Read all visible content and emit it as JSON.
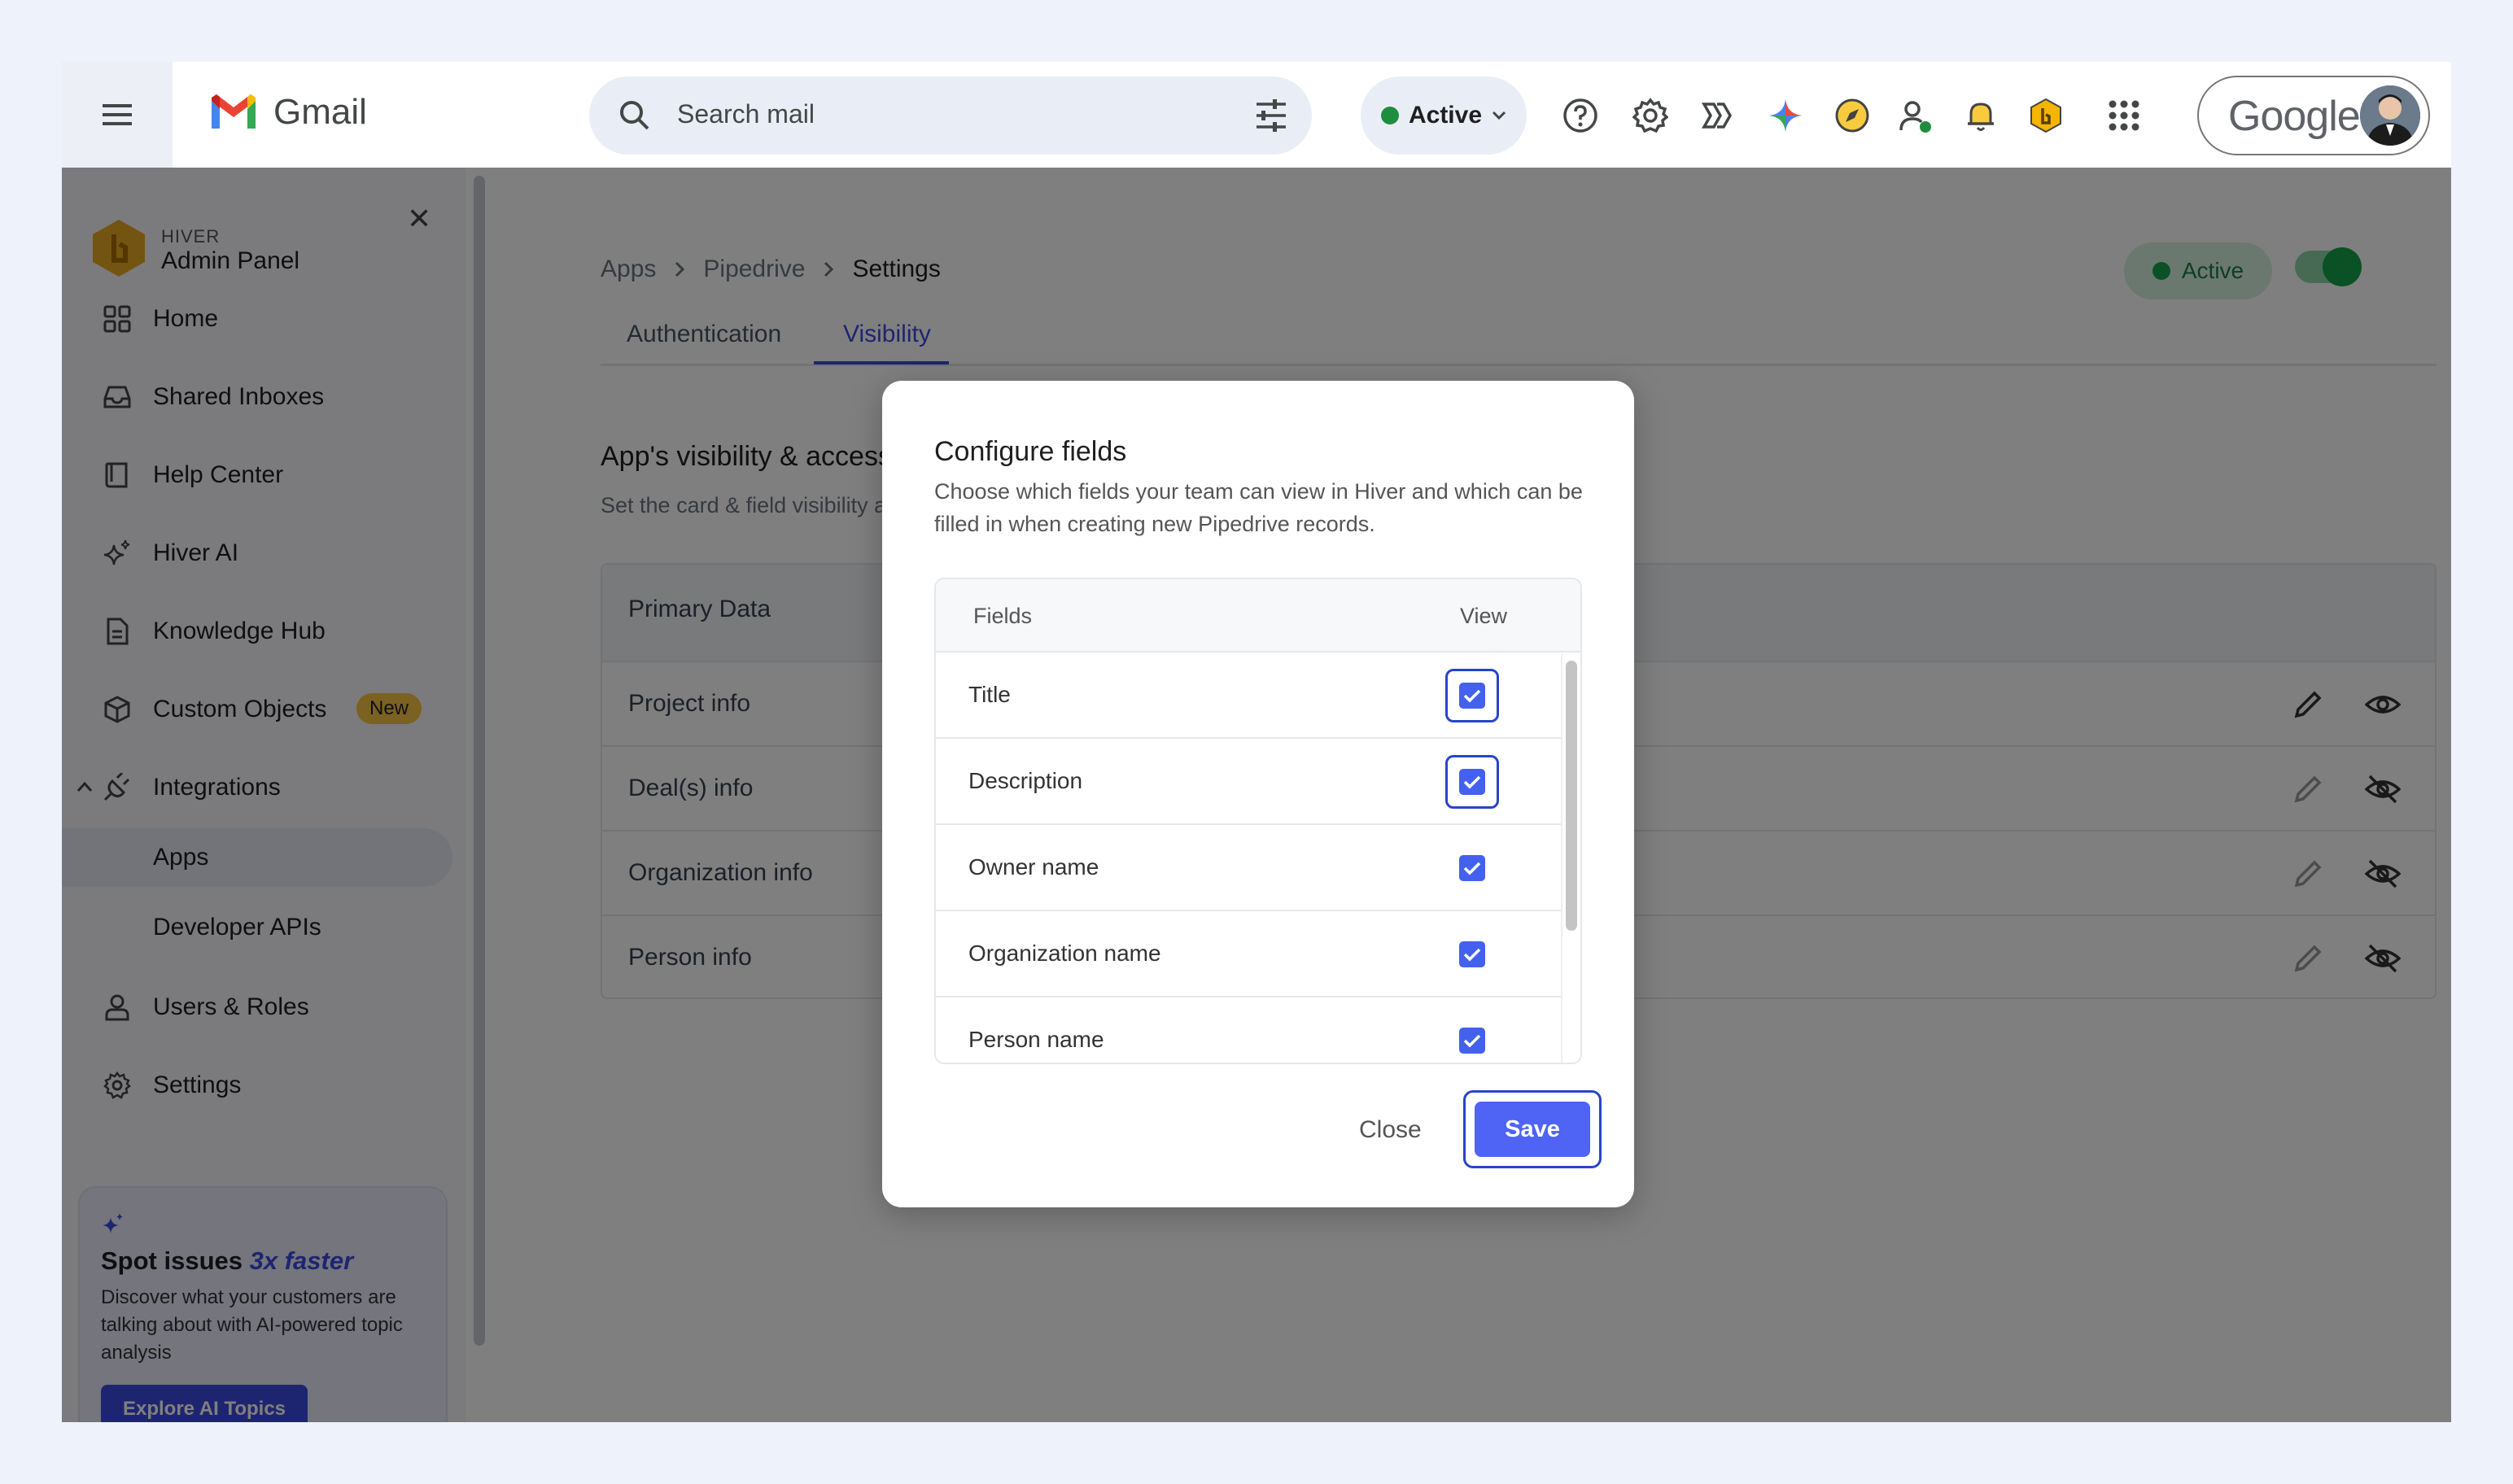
{
  "gmail": {
    "app_name": "Gmail",
    "search_placeholder": "Search mail",
    "status_label": "Active",
    "google_label": "Google"
  },
  "sidebar": {
    "brand_small": "HIVER",
    "brand_title": "Admin Panel",
    "items": [
      {
        "label": "Home",
        "icon": "grid-icon"
      },
      {
        "label": "Shared Inboxes",
        "icon": "inbox-icon"
      },
      {
        "label": "Help Center",
        "icon": "book-icon"
      },
      {
        "label": "Hiver AI",
        "icon": "sparkle-icon"
      },
      {
        "label": "Knowledge Hub",
        "icon": "document-icon"
      },
      {
        "label": "Custom Objects",
        "icon": "cube-icon",
        "badge": "New"
      },
      {
        "label": "Integrations",
        "icon": "plug-icon"
      },
      {
        "label": "Apps"
      },
      {
        "label": "Developer APIs"
      },
      {
        "label": "Users & Roles",
        "icon": "user-icon"
      },
      {
        "label": "Settings",
        "icon": "gear-icon"
      }
    ],
    "promo": {
      "title_prefix": "Spot issues ",
      "title_highlight": "3x faster",
      "body": "Discover what your customers are talking about with AI-powered topic analysis",
      "button": "Explore AI Topics"
    }
  },
  "main": {
    "breadcrumb": [
      "Apps",
      "Pipedrive",
      "Settings"
    ],
    "status_pill": "Active",
    "tabs": [
      "Authentication",
      "Visibility"
    ],
    "section_title": "App's visibility & access",
    "section_subtitle": "Set the card & field visibility acros",
    "table_header": "Primary Data",
    "rows": [
      "Project info",
      "Deal(s) info",
      "Organization info",
      "Person info"
    ]
  },
  "modal": {
    "title": "Configure fields",
    "description": "Choose which fields your team can view in Hiver and which can be filled in when creating new Pipedrive records.",
    "col_fields": "Fields",
    "col_view": "View",
    "fields": [
      {
        "label": "Title",
        "checked": true
      },
      {
        "label": "Description",
        "checked": true
      },
      {
        "label": "Owner name",
        "checked": true
      },
      {
        "label": "Organization name",
        "checked": true
      },
      {
        "label": "Person name",
        "checked": true
      }
    ],
    "close_label": "Close",
    "save_label": "Save"
  },
  "colors": {
    "accent": "#3d4be0",
    "save_button": "#4f63f5",
    "active_green": "#15a34a",
    "badge_yellow": "#f6c344"
  }
}
